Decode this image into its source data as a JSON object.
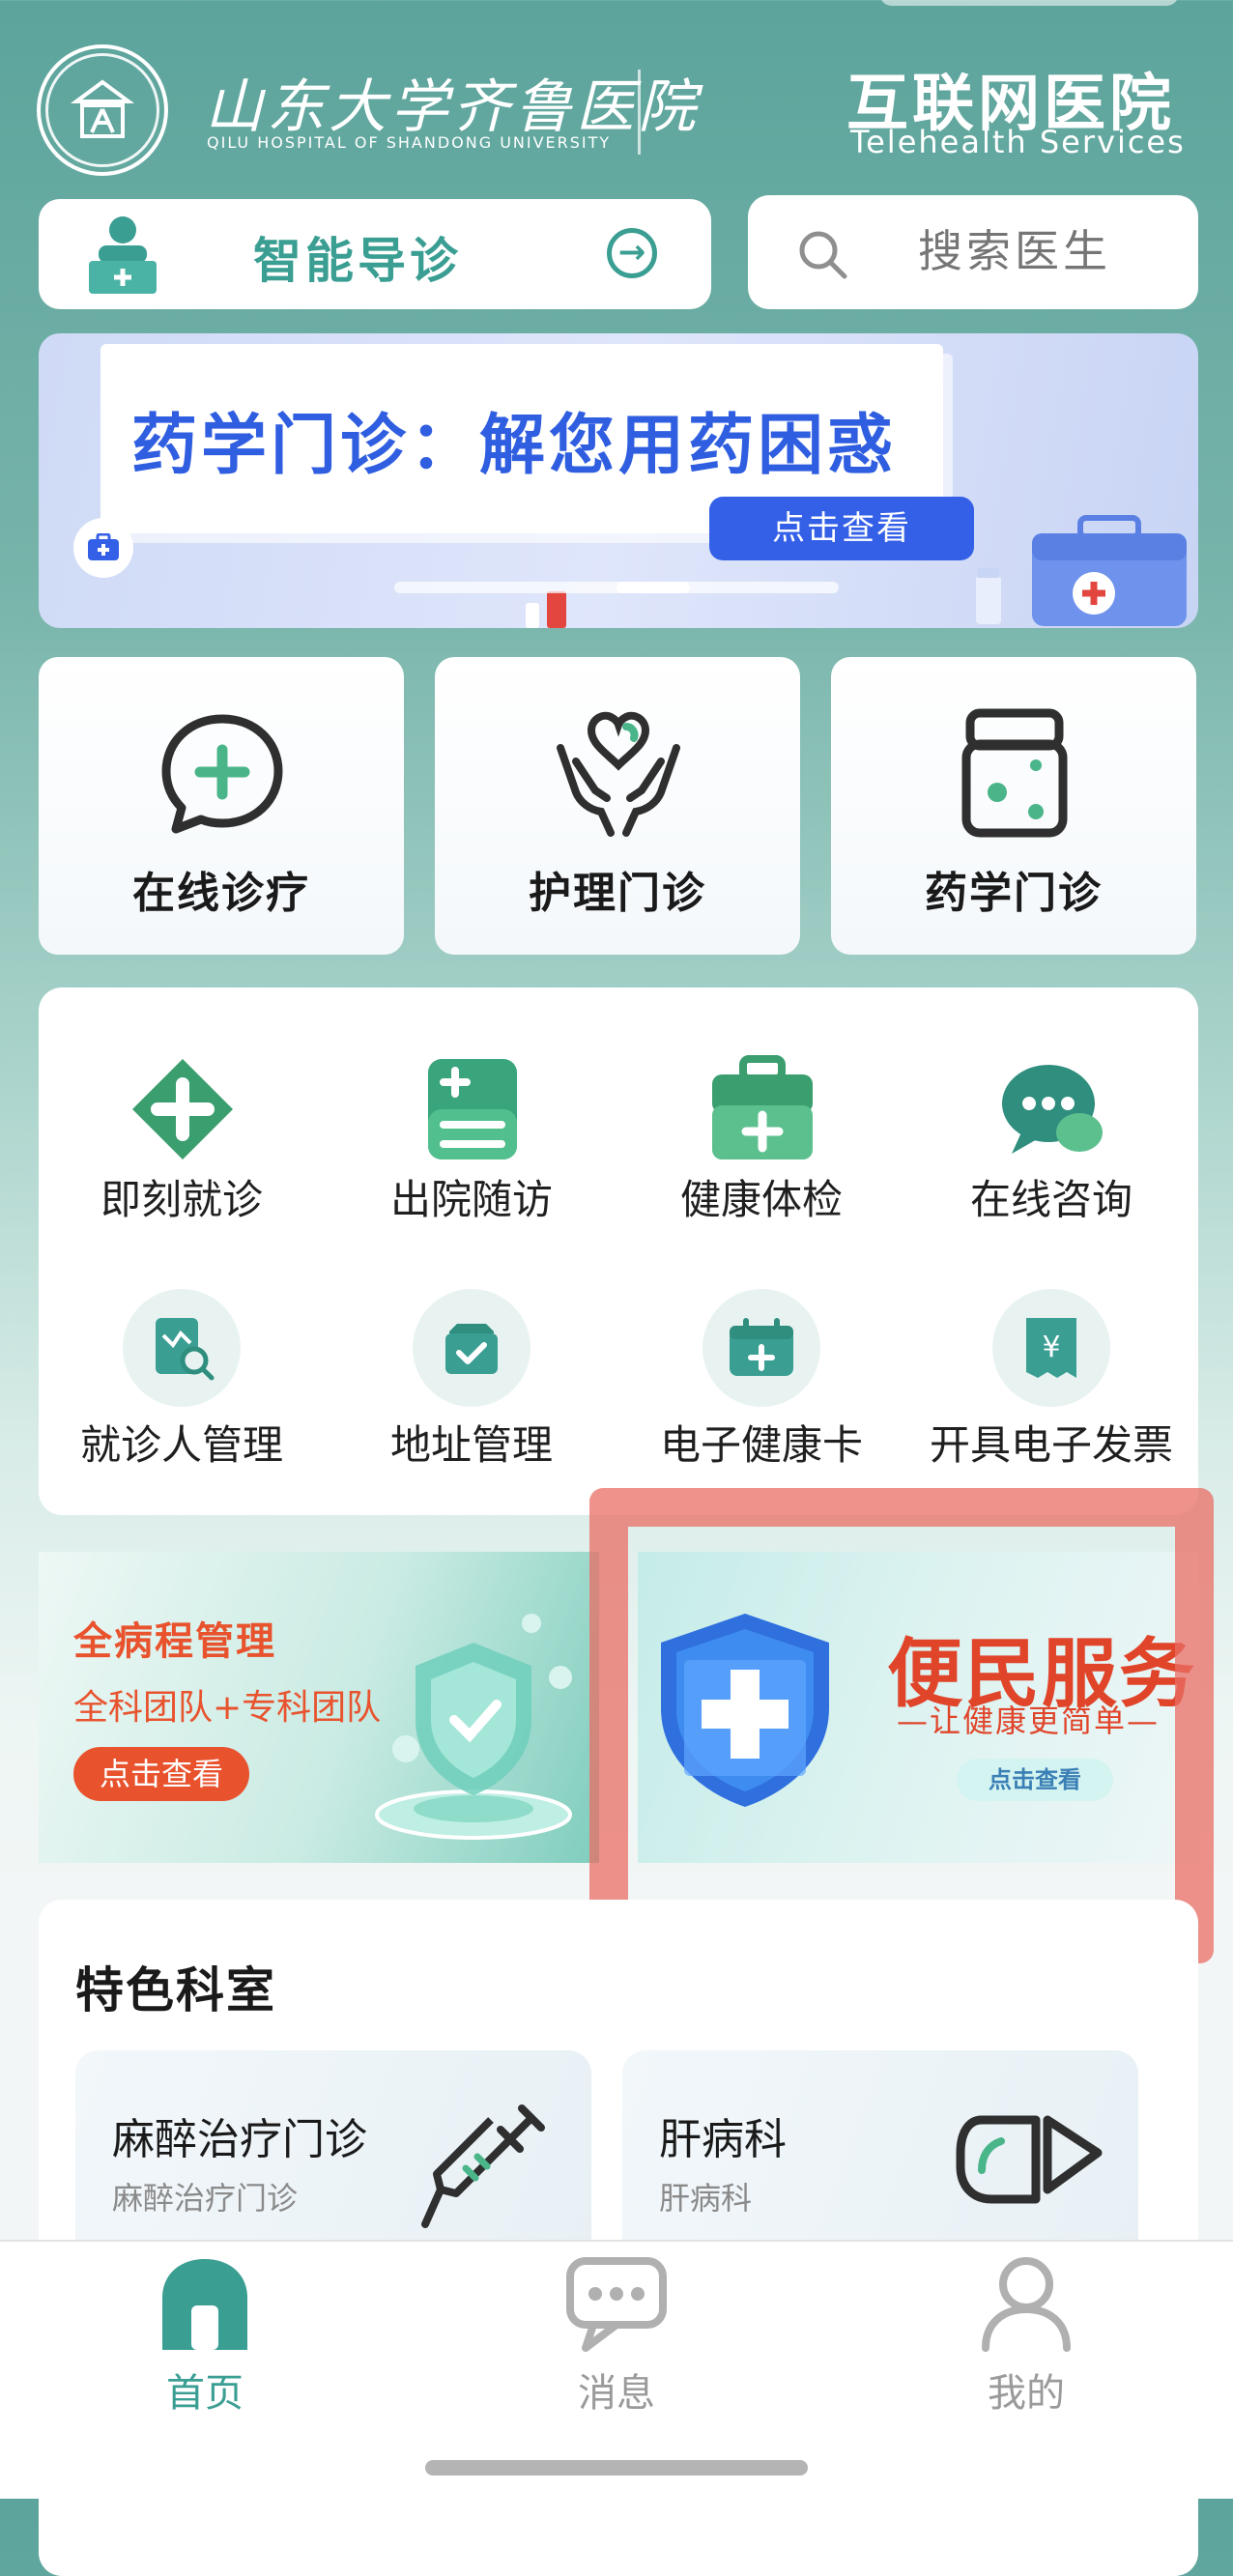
{
  "header": {
    "hospital_name_cn": "山东大学齐鲁医院",
    "hospital_name_en": "QILU HOSPITAL OF SHANDONG UNIVERSITY",
    "service_name_cn": "互联网医院",
    "service_name_en": "Telehealth Services"
  },
  "search_row": {
    "guide_label": "智能导诊",
    "search_placeholder": "搜索医生"
  },
  "banner": {
    "title": "药学门诊：解您用药困惑",
    "button_label": "点击查看",
    "page_count": 2,
    "active_page": 1
  },
  "main_cards": [
    {
      "label": "在线诊疗",
      "icon": "chat-plus-icon"
    },
    {
      "label": "护理门诊",
      "icon": "care-hands-icon"
    },
    {
      "label": "药学门诊",
      "icon": "medicine-jar-icon"
    }
  ],
  "services": [
    {
      "label": "即刻就诊",
      "icon": "medical-cross-icon"
    },
    {
      "label": "出院随访",
      "icon": "calculator-icon"
    },
    {
      "label": "健康体检",
      "icon": "medical-kit-icon"
    },
    {
      "label": "在线咨询",
      "icon": "chat-bubbles-icon"
    },
    {
      "label": "就诊人管理",
      "icon": "patient-search-icon"
    },
    {
      "label": "地址管理",
      "icon": "address-check-icon"
    },
    {
      "label": "电子健康卡",
      "icon": "health-card-icon"
    },
    {
      "label": "开具电子发票",
      "icon": "invoice-icon"
    }
  ],
  "promos": {
    "left": {
      "title": "全病程管理",
      "subtitle": "全科团队+专科团队",
      "button_label": "点击查看"
    },
    "right": {
      "title": "便民服务",
      "subtitle": "—让健康更简单—",
      "button_label": "点击查看"
    }
  },
  "departments": {
    "heading": "特色科室",
    "items": [
      {
        "name": "麻醉治疗门诊",
        "subtitle": "麻醉治疗门诊",
        "icon": "syringe-icon"
      },
      {
        "name": "肝病科",
        "subtitle": "肝病科",
        "icon": "liver-icon"
      }
    ]
  },
  "bottom_nav": {
    "items": [
      {
        "label": "首页",
        "icon": "home-icon",
        "active": true
      },
      {
        "label": "消息",
        "icon": "message-icon",
        "active": false
      },
      {
        "label": "我的",
        "icon": "profile-icon",
        "active": false
      }
    ]
  },
  "colors": {
    "brand_teal": "#3a9e93",
    "banner_blue": "#2f5ee0",
    "promo_red": "#e0452a",
    "highlight": "#e96e64",
    "nav_inactive": "#b0b0b0"
  }
}
